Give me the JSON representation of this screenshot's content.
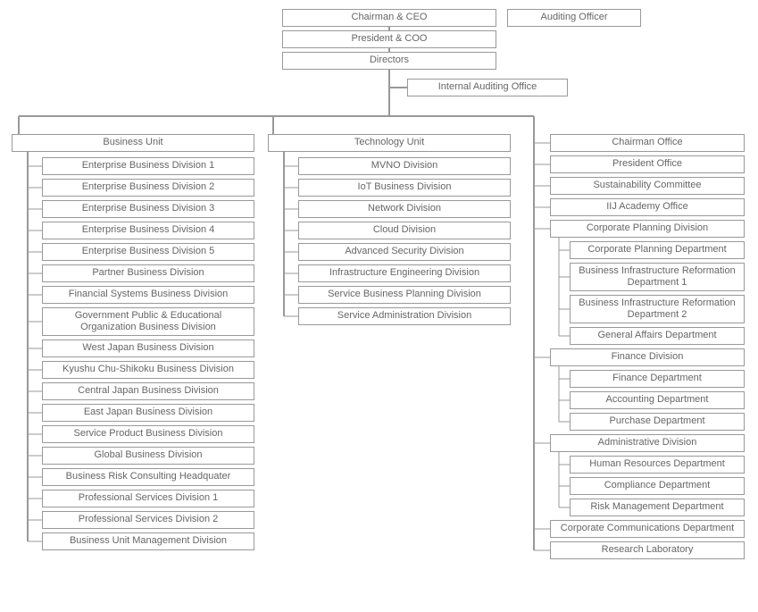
{
  "top": {
    "ceo": "Chairman & CEO",
    "coo": "President & COO",
    "directors": "Directors",
    "auditing_officer": "Auditing Officer",
    "internal_audit": "Internal Auditing Office"
  },
  "business": {
    "title": "Business Unit",
    "items": [
      "Enterprise Business Division 1",
      "Enterprise Business Division 2",
      "Enterprise Business Division 3",
      "Enterprise Business Division 4",
      "Enterprise Business Division 5",
      "Partner Business Division",
      "Financial Systems Business Division",
      "Government Public & Educational Organization Business Division",
      "West Japan Business Division",
      "Kyushu Chu-Shikoku Business Division",
      "Central Japan Business Division",
      "East Japan Business Division",
      "Service Product Business Division",
      "Global Business Division",
      "Business Risk Consulting Headquater",
      "Professional Services Division 1",
      "Professional Services Division 2",
      "Business Unit Management Division"
    ]
  },
  "technology": {
    "title": "Technology Unit",
    "items": [
      "MVNO Division",
      "IoT Business Division",
      "Network Division",
      "Cloud Division",
      "Advanced Security Division",
      "Infrastructure Engineering Division",
      "Service Business Planning Division",
      "Service Administration Division"
    ]
  },
  "corporate": [
    {
      "label": "Chairman Office"
    },
    {
      "label": "President Office"
    },
    {
      "label": "Sustainability Committee"
    },
    {
      "label": "IIJ Academy Office"
    },
    {
      "label": "Corporate Planning Division",
      "children": [
        "Corporate Planning Department",
        "Business Infrastructure Reformation Department 1",
        "Business Infrastructure Reformation Department 2",
        "General Affairs Department"
      ]
    },
    {
      "label": "Finance Division",
      "children": [
        "Finance Department",
        "Accounting Department",
        "Purchase Department"
      ]
    },
    {
      "label": "Administrative Division",
      "children": [
        "Human Resources Department",
        "Compliance Department",
        "Risk Management Department"
      ]
    },
    {
      "label": "Corporate Communications Department"
    },
    {
      "label": "Research Laboratory"
    }
  ]
}
